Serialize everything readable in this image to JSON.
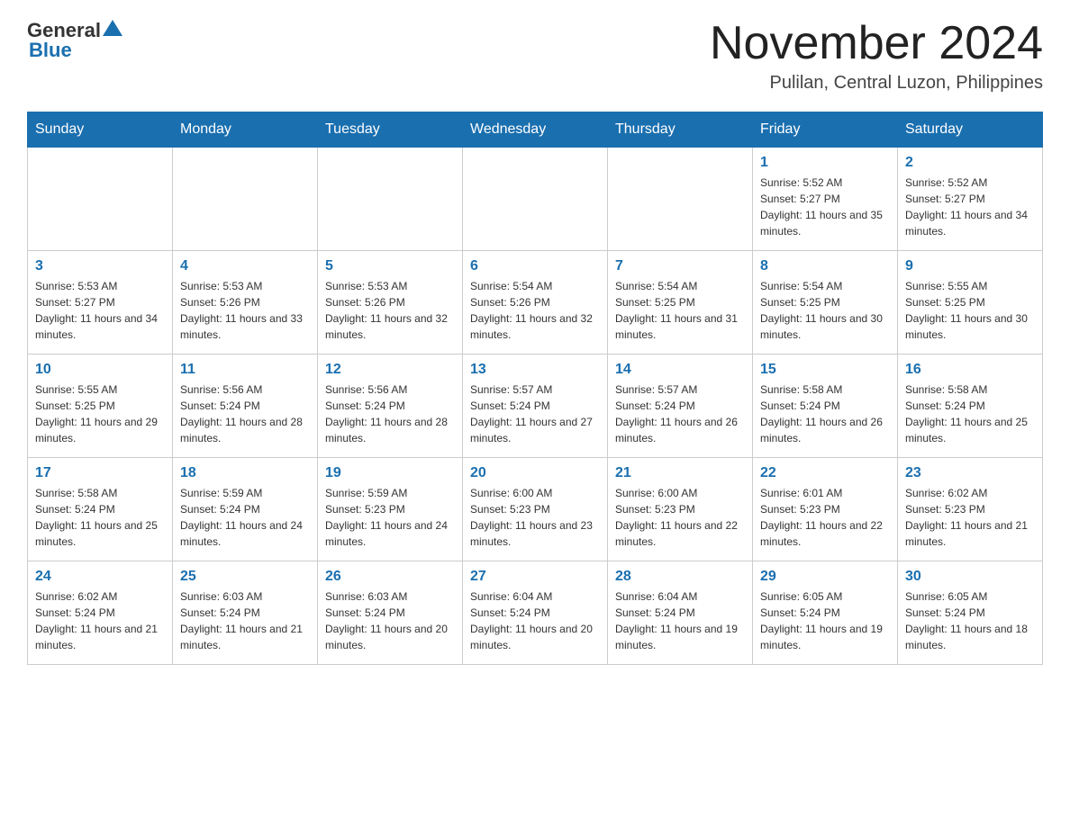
{
  "header": {
    "logo": {
      "general": "General",
      "blue": "Blue"
    },
    "title": "November 2024",
    "location": "Pulilan, Central Luzon, Philippines"
  },
  "weekdays": [
    "Sunday",
    "Monday",
    "Tuesday",
    "Wednesday",
    "Thursday",
    "Friday",
    "Saturday"
  ],
  "weeks": [
    [
      {
        "day": "",
        "info": ""
      },
      {
        "day": "",
        "info": ""
      },
      {
        "day": "",
        "info": ""
      },
      {
        "day": "",
        "info": ""
      },
      {
        "day": "",
        "info": ""
      },
      {
        "day": "1",
        "info": "Sunrise: 5:52 AM\nSunset: 5:27 PM\nDaylight: 11 hours and 35 minutes."
      },
      {
        "day": "2",
        "info": "Sunrise: 5:52 AM\nSunset: 5:27 PM\nDaylight: 11 hours and 34 minutes."
      }
    ],
    [
      {
        "day": "3",
        "info": "Sunrise: 5:53 AM\nSunset: 5:27 PM\nDaylight: 11 hours and 34 minutes."
      },
      {
        "day": "4",
        "info": "Sunrise: 5:53 AM\nSunset: 5:26 PM\nDaylight: 11 hours and 33 minutes."
      },
      {
        "day": "5",
        "info": "Sunrise: 5:53 AM\nSunset: 5:26 PM\nDaylight: 11 hours and 32 minutes."
      },
      {
        "day": "6",
        "info": "Sunrise: 5:54 AM\nSunset: 5:26 PM\nDaylight: 11 hours and 32 minutes."
      },
      {
        "day": "7",
        "info": "Sunrise: 5:54 AM\nSunset: 5:25 PM\nDaylight: 11 hours and 31 minutes."
      },
      {
        "day": "8",
        "info": "Sunrise: 5:54 AM\nSunset: 5:25 PM\nDaylight: 11 hours and 30 minutes."
      },
      {
        "day": "9",
        "info": "Sunrise: 5:55 AM\nSunset: 5:25 PM\nDaylight: 11 hours and 30 minutes."
      }
    ],
    [
      {
        "day": "10",
        "info": "Sunrise: 5:55 AM\nSunset: 5:25 PM\nDaylight: 11 hours and 29 minutes."
      },
      {
        "day": "11",
        "info": "Sunrise: 5:56 AM\nSunset: 5:24 PM\nDaylight: 11 hours and 28 minutes."
      },
      {
        "day": "12",
        "info": "Sunrise: 5:56 AM\nSunset: 5:24 PM\nDaylight: 11 hours and 28 minutes."
      },
      {
        "day": "13",
        "info": "Sunrise: 5:57 AM\nSunset: 5:24 PM\nDaylight: 11 hours and 27 minutes."
      },
      {
        "day": "14",
        "info": "Sunrise: 5:57 AM\nSunset: 5:24 PM\nDaylight: 11 hours and 26 minutes."
      },
      {
        "day": "15",
        "info": "Sunrise: 5:58 AM\nSunset: 5:24 PM\nDaylight: 11 hours and 26 minutes."
      },
      {
        "day": "16",
        "info": "Sunrise: 5:58 AM\nSunset: 5:24 PM\nDaylight: 11 hours and 25 minutes."
      }
    ],
    [
      {
        "day": "17",
        "info": "Sunrise: 5:58 AM\nSunset: 5:24 PM\nDaylight: 11 hours and 25 minutes."
      },
      {
        "day": "18",
        "info": "Sunrise: 5:59 AM\nSunset: 5:24 PM\nDaylight: 11 hours and 24 minutes."
      },
      {
        "day": "19",
        "info": "Sunrise: 5:59 AM\nSunset: 5:23 PM\nDaylight: 11 hours and 24 minutes."
      },
      {
        "day": "20",
        "info": "Sunrise: 6:00 AM\nSunset: 5:23 PM\nDaylight: 11 hours and 23 minutes."
      },
      {
        "day": "21",
        "info": "Sunrise: 6:00 AM\nSunset: 5:23 PM\nDaylight: 11 hours and 22 minutes."
      },
      {
        "day": "22",
        "info": "Sunrise: 6:01 AM\nSunset: 5:23 PM\nDaylight: 11 hours and 22 minutes."
      },
      {
        "day": "23",
        "info": "Sunrise: 6:02 AM\nSunset: 5:23 PM\nDaylight: 11 hours and 21 minutes."
      }
    ],
    [
      {
        "day": "24",
        "info": "Sunrise: 6:02 AM\nSunset: 5:24 PM\nDaylight: 11 hours and 21 minutes."
      },
      {
        "day": "25",
        "info": "Sunrise: 6:03 AM\nSunset: 5:24 PM\nDaylight: 11 hours and 21 minutes."
      },
      {
        "day": "26",
        "info": "Sunrise: 6:03 AM\nSunset: 5:24 PM\nDaylight: 11 hours and 20 minutes."
      },
      {
        "day": "27",
        "info": "Sunrise: 6:04 AM\nSunset: 5:24 PM\nDaylight: 11 hours and 20 minutes."
      },
      {
        "day": "28",
        "info": "Sunrise: 6:04 AM\nSunset: 5:24 PM\nDaylight: 11 hours and 19 minutes."
      },
      {
        "day": "29",
        "info": "Sunrise: 6:05 AM\nSunset: 5:24 PM\nDaylight: 11 hours and 19 minutes."
      },
      {
        "day": "30",
        "info": "Sunrise: 6:05 AM\nSunset: 5:24 PM\nDaylight: 11 hours and 18 minutes."
      }
    ]
  ]
}
